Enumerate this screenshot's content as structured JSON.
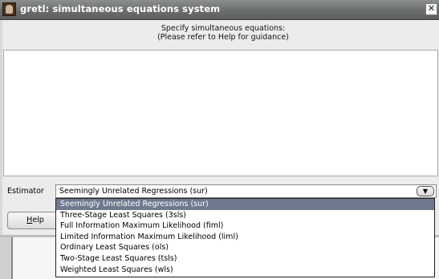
{
  "window": {
    "title": "gretl: simultaneous equations system",
    "close_glyph": "✕"
  },
  "prompt": {
    "line1": "Specify simultaneous equations:",
    "line2": "(Please refer to Help for guidance)"
  },
  "equations_text": "",
  "estimator": {
    "label": "Estimator",
    "selected": "Seemingly Unrelated Regressions (sur)",
    "arrow_glyph": "▼",
    "options": [
      "Seemingly Unrelated Regressions (sur)",
      "Three-Stage Least Squares (3sls)",
      "Full Information Maximum Likelihood (fiml)",
      "Limited Information Maximum Likelihood (liml)",
      "Ordinary Least Squares (ols)",
      "Two-Stage Least Squares (tsls)",
      "Weighted Least Squares (wls)"
    ]
  },
  "buttons": {
    "help_mnemonic": "H",
    "help_rest": "elp"
  },
  "colors": {
    "selection": "#6f7a8f",
    "titlebar": "#6b6e6c"
  }
}
